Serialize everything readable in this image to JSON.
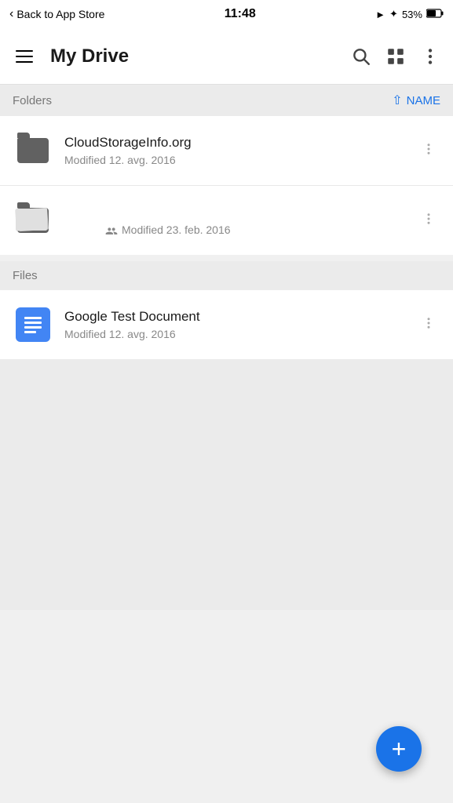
{
  "statusBar": {
    "backLabel": "Back to App Store",
    "time": "11:48",
    "battery": "53%"
  },
  "header": {
    "title": "My Drive",
    "searchLabel": "search",
    "gridLabel": "grid view",
    "moreLabel": "more options"
  },
  "foldersSection": {
    "label": "Folders",
    "sortLabel": "NAME"
  },
  "folders": [
    {
      "name": "CloudStorageInfo.org",
      "modified": "Modified 12. avg. 2016",
      "type": "folder",
      "shared": false
    },
    {
      "name": "",
      "modified": "Modified 23. feb. 2016",
      "type": "shared-folder",
      "shared": true
    }
  ],
  "filesSection": {
    "label": "Files"
  },
  "files": [
    {
      "name": "Google Test Document",
      "modified": "Modified 12. avg. 2016",
      "type": "doc"
    }
  ],
  "fab": {
    "label": "+"
  }
}
